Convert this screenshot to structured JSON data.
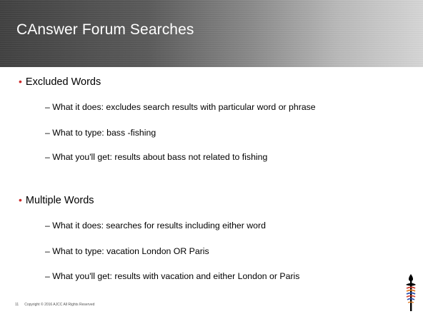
{
  "slide": {
    "title": "CAnswer Forum Searches",
    "sections": [
      {
        "heading": "Excluded Words",
        "items": [
          "– What it does: excludes search results with particular word or phrase",
          "– What to type: bass -fishing",
          "– What you'll get: results about bass not related to fishing"
        ]
      },
      {
        "heading": "Multiple Words",
        "items": [
          "– What it does: searches for results including either word",
          "– What to type: vacation London OR Paris",
          "– What you'll get: results with vacation and either London or Paris"
        ]
      }
    ],
    "bullet_char": "•",
    "footer": {
      "page_number": "11",
      "copyright": "Copyright © 2016  AJCC  All Rights Reserved"
    },
    "logo_icon": "ajcc-torch-logo"
  },
  "colors": {
    "bullet": "#cc2a2a",
    "title_text": "#ffffff",
    "title_bar_dark": "#3f3f3f",
    "title_bar_light": "#d6d6d6"
  }
}
